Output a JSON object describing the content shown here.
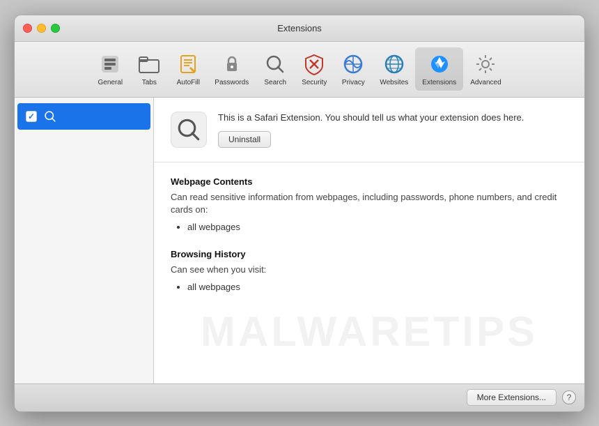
{
  "window": {
    "title": "Extensions"
  },
  "toolbar": {
    "items": [
      {
        "id": "general",
        "label": "General",
        "icon": "general-icon"
      },
      {
        "id": "tabs",
        "label": "Tabs",
        "icon": "tabs-icon"
      },
      {
        "id": "autofill",
        "label": "AutoFill",
        "icon": "autofill-icon"
      },
      {
        "id": "passwords",
        "label": "Passwords",
        "icon": "passwords-icon"
      },
      {
        "id": "search",
        "label": "Search",
        "icon": "search-icon"
      },
      {
        "id": "security",
        "label": "Security",
        "icon": "security-icon"
      },
      {
        "id": "privacy",
        "label": "Privacy",
        "icon": "privacy-icon"
      },
      {
        "id": "websites",
        "label": "Websites",
        "icon": "websites-icon"
      },
      {
        "id": "extensions",
        "label": "Extensions",
        "icon": "extensions-icon",
        "active": true
      },
      {
        "id": "advanced",
        "label": "Advanced",
        "icon": "advanced-icon"
      }
    ]
  },
  "sidebar": {
    "items": [
      {
        "id": "search-ext",
        "label": "",
        "checked": true,
        "selected": true
      }
    ]
  },
  "detail": {
    "extension": {
      "description": "This is a Safari Extension. You should tell us what your extension does here.",
      "uninstall_label": "Uninstall"
    },
    "permissions": [
      {
        "title": "Webpage Contents",
        "description": "Can read sensitive information from webpages, including passwords, phone numbers, and credit cards on:",
        "items": [
          "all webpages"
        ]
      },
      {
        "title": "Browsing History",
        "description": "Can see when you visit:",
        "items": [
          "all webpages"
        ]
      }
    ],
    "watermark": "MALWARETIPS"
  },
  "footer": {
    "more_extensions_label": "More Extensions...",
    "help_label": "?"
  }
}
